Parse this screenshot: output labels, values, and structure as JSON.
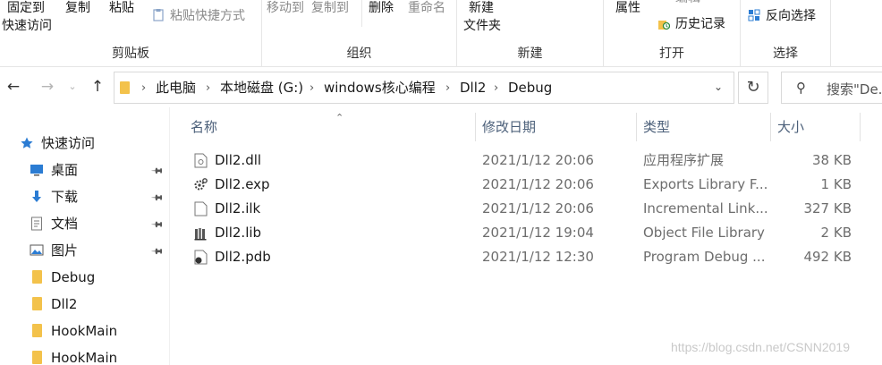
{
  "ribbon": {
    "clipboard": {
      "pin_quick_access": "固定到\n快速访问",
      "pin_line1": "固定到",
      "pin_line2": "快速访问",
      "copy": "复制",
      "paste": "粘贴",
      "paste_shortcut": "粘贴快捷方式",
      "group_label": "剪贴板"
    },
    "organize": {
      "move_to": "移动到",
      "copy_to": "复制到",
      "delete": "删除",
      "rename": "重命名",
      "group_label": "组织"
    },
    "new": {
      "new_folder_line1": "新建",
      "new_folder_line2": "文件夹",
      "group_label": "新建"
    },
    "open": {
      "properties": "属性",
      "edit": "编辑",
      "history": "历史记录",
      "group_label": "打开"
    },
    "select": {
      "invert_selection": "反向选择",
      "group_label": "选择"
    }
  },
  "address": {
    "crumbs": [
      "此电脑",
      "本地磁盘 (G:)",
      "windows核心编程",
      "Dll2",
      "Debug"
    ],
    "search_placeholder": "搜索\"De..."
  },
  "navpane": {
    "quick_access": "快速访问",
    "items": [
      {
        "label": "桌面",
        "icon": "desktop-icon",
        "pinned": true
      },
      {
        "label": "下载",
        "icon": "download-icon",
        "pinned": true
      },
      {
        "label": "文档",
        "icon": "documents-icon",
        "pinned": true
      },
      {
        "label": "图片",
        "icon": "pictures-icon",
        "pinned": true
      },
      {
        "label": "Debug",
        "icon": "folder-icon",
        "pinned": false
      },
      {
        "label": "Dll2",
        "icon": "folder-icon",
        "pinned": false
      },
      {
        "label": "HookMain",
        "icon": "folder-icon",
        "pinned": false
      },
      {
        "label": "HookMain",
        "icon": "folder-icon",
        "pinned": false
      }
    ]
  },
  "filelist": {
    "columns": {
      "name": "名称",
      "modified": "修改日期",
      "type": "类型",
      "size": "大小"
    },
    "rows": [
      {
        "name": "Dll2.dll",
        "modified": "2021/1/12 20:06",
        "type": "应用程序扩展",
        "size": "38 KB",
        "icon": "dll-file-icon"
      },
      {
        "name": "Dll2.exp",
        "modified": "2021/1/12 20:06",
        "type": "Exports Library F...",
        "size": "1 KB",
        "icon": "exp-file-icon"
      },
      {
        "name": "Dll2.ilk",
        "modified": "2021/1/12 20:06",
        "type": "Incremental Link...",
        "size": "327 KB",
        "icon": "ilk-file-icon"
      },
      {
        "name": "Dll2.lib",
        "modified": "2021/1/12 19:04",
        "type": "Object File Library",
        "size": "2 KB",
        "icon": "lib-file-icon"
      },
      {
        "name": "Dll2.pdb",
        "modified": "2021/1/12 12:30",
        "type": "Program Debug ...",
        "size": "492 KB",
        "icon": "pdb-file-icon"
      }
    ]
  },
  "watermark": "https://blog.csdn.net/CSNN2019",
  "colors": {
    "folder": "#f3c24b",
    "header_text": "#4c607a",
    "accent": "#2b7cd3"
  }
}
